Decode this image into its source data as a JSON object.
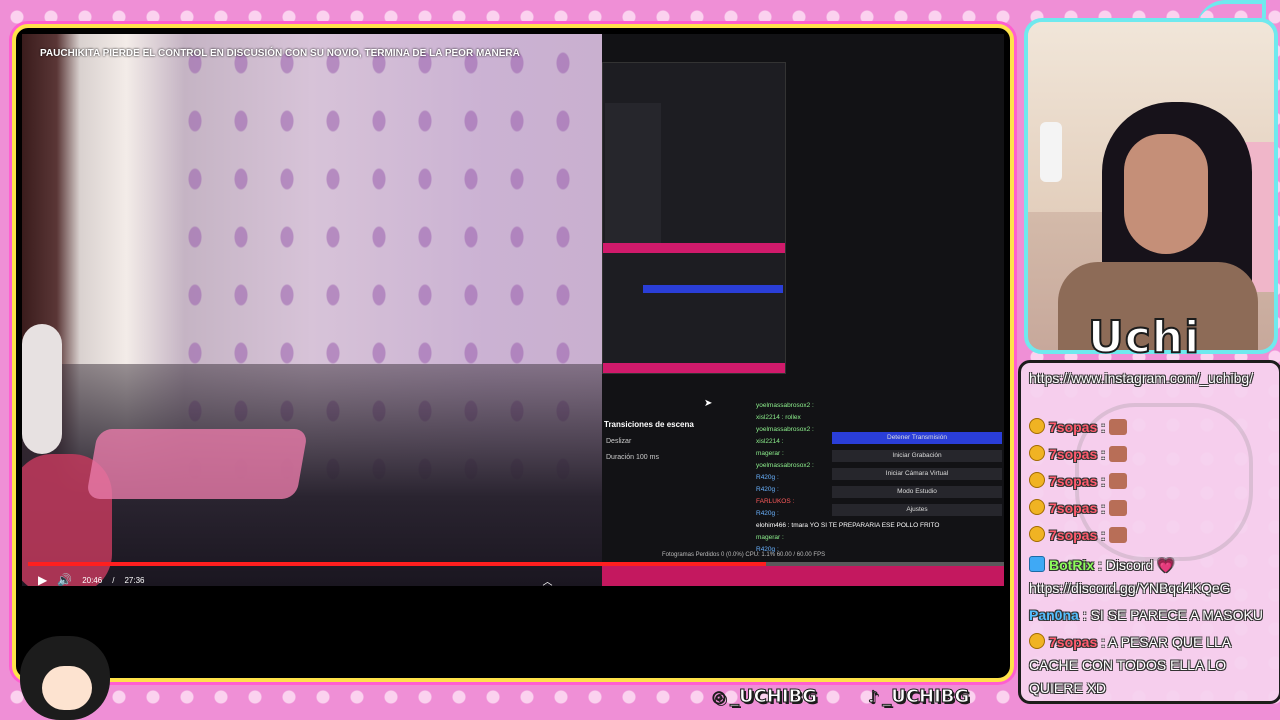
{
  "video": {
    "title": "PAUCHIKITA PIERDE EL CONTROL EN DISCUSIÓN CON SU NOVIO, TERMINA DE LA PEOR MANERA",
    "time_current": "20:46",
    "time_total": "27:36",
    "progress": 0.752,
    "obs": {
      "scene_transitions_label": "Transiciones de escena",
      "transition_value": "Deslizar",
      "duration_label": "Duración",
      "duration_value": "100 ms",
      "buttons": [
        "Detener Transmisión",
        "Iniciar Grabación",
        "Iniciar Cámara Virtual",
        "Modo Estudio",
        "Ajustes"
      ],
      "chat_lines": [
        "yoelmassabrosox2 :",
        "xisl2214 : rollex",
        "yoelmassabrosox2 :",
        "xisl2214 :",
        "magerar :",
        "yoelmassabrosox2 :",
        "R420g :",
        "R420g :",
        "FARLUKOS :",
        "R420g :",
        "elohim466 : tmara YO SI TE PREPARARIA ESE POLLO FRITO",
        "magerar :",
        "R420g :"
      ],
      "stats": "Fotogramas Perdidos 0 (0.0%)  CPU: 1.1%  60.00 / 60.00 FPS"
    }
  },
  "cam": {
    "streamer_name": "Uchi"
  },
  "chat": {
    "messages": [
      {
        "user": "",
        "text": "https://www.instagram.com/_uchibg/"
      },
      {
        "user": "7sopas",
        "text": ":"
      },
      {
        "user": "7sopas",
        "text": ":"
      },
      {
        "user": "7sopas",
        "text": ":"
      },
      {
        "user": "7sopas",
        "text": ":"
      },
      {
        "user": "7sopas",
        "text": ":"
      },
      {
        "user": "BotRix",
        "text": ": Discord 💗 https://discord.gg/YNBqd4KQeG"
      },
      {
        "user": "Pan0na",
        "text": ": SI SE PARECE A MASOKU"
      },
      {
        "user": "7sopas",
        "text": ": A PESAR QUE LLA CACHE CON TODOS ELLA LO QUIERE XD"
      }
    ]
  },
  "socials": {
    "instagram": "_UCHIBG",
    "tiktok": "_UCHIBG"
  },
  "colors": {
    "frame_border": "#ffe34a",
    "cam_border": "#6fe9ee",
    "background": "#ef8fd6",
    "progress": "#ff1f1f"
  }
}
